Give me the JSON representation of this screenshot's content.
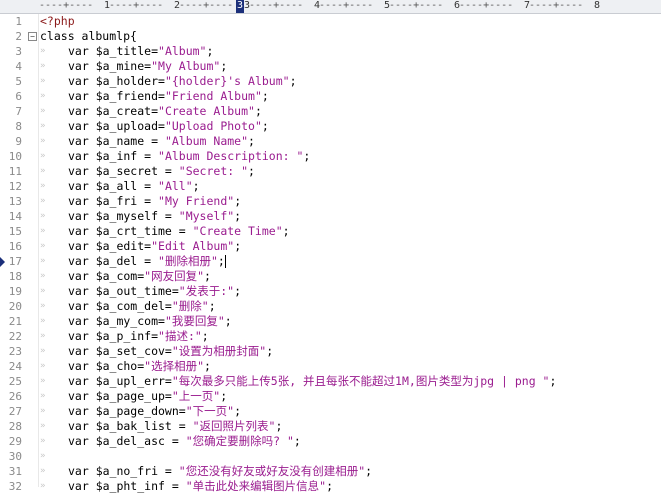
{
  "ruler": {
    "numbers": [
      "1",
      "2",
      "3",
      "4",
      "5",
      "6",
      "7",
      "8"
    ],
    "cursor_col": "3"
  },
  "code_lines": [
    {
      "n": "1",
      "text": "<?php",
      "kind": "php"
    },
    {
      "n": "2",
      "text": "class albumlp{",
      "kind": "class",
      "fold": "−"
    },
    {
      "n": "3",
      "pre": "var $a_title=",
      "str": "\"Album\"",
      "post": ";"
    },
    {
      "n": "4",
      "pre": "var $a_mine=",
      "str": "\"My Album\"",
      "post": ";"
    },
    {
      "n": "5",
      "pre": "var $a_holder=",
      "str": "\"{holder}'s Album\"",
      "post": ";"
    },
    {
      "n": "6",
      "pre": "var $a_friend=",
      "str": "\"Friend Album\"",
      "post": ";"
    },
    {
      "n": "7",
      "pre": "var $a_creat=",
      "str": "\"Create Album\"",
      "post": ";"
    },
    {
      "n": "8",
      "pre": "var $a_upload=",
      "str": "\"Upload Photo\"",
      "post": ";"
    },
    {
      "n": "9",
      "pre": "var $a_name = ",
      "str": "\"Album Name\"",
      "post": ";"
    },
    {
      "n": "10",
      "pre": "var $a_inf = ",
      "str": "\"Album Description: \"",
      "post": ";"
    },
    {
      "n": "11",
      "pre": "var $a_secret = ",
      "str": "\"Secret: \"",
      "post": ";"
    },
    {
      "n": "12",
      "pre": "var $a_all = ",
      "str": "\"All\"",
      "post": ";"
    },
    {
      "n": "13",
      "pre": "var $a_fri = ",
      "str": "\"My Friend\"",
      "post": ";"
    },
    {
      "n": "14",
      "pre": "var $a_myself = ",
      "str": "\"Myself\"",
      "post": ";"
    },
    {
      "n": "15",
      "pre": "var $a_crt_time = ",
      "str": "\"Create Time\"",
      "post": ";"
    },
    {
      "n": "16",
      "pre": "var $a_edit=",
      "str": "\"Edit Album\"",
      "post": ";"
    },
    {
      "n": "17",
      "pre": "var $a_del = ",
      "str": "\"删除相册\"",
      "post": ";",
      "current": true
    },
    {
      "n": "18",
      "pre": "var $a_com=",
      "str": "\"网友回复\"",
      "post": ";"
    },
    {
      "n": "19",
      "pre": "var $a_out_time=",
      "str": "\"发表于:\"",
      "post": ";"
    },
    {
      "n": "20",
      "pre": "var $a_com_del=",
      "str": "\"删除\"",
      "post": ";"
    },
    {
      "n": "21",
      "pre": "var $a_my_com=",
      "str": "\"我要回复\"",
      "post": ";"
    },
    {
      "n": "22",
      "pre": "var $a_p_inf=",
      "str": "\"描述:\"",
      "post": ";"
    },
    {
      "n": "23",
      "pre": "var $a_set_cov=",
      "str": "\"设置为相册封面\"",
      "post": ";"
    },
    {
      "n": "24",
      "pre": "var $a_cho=",
      "str": "\"选择相册\"",
      "post": ";"
    },
    {
      "n": "25",
      "pre": "var $a_upl_err=",
      "str": "\"每次最多只能上传5张, 并且每张不能超过1M,图片类型为jpg | png \"",
      "post": ";"
    },
    {
      "n": "26",
      "pre": "var $a_page_up=",
      "str": "\"上一页\"",
      "post": ";"
    },
    {
      "n": "27",
      "pre": "var $a_page_down=",
      "str": "\"下一页\"",
      "post": ";"
    },
    {
      "n": "28",
      "pre": "var $a_bak_list = ",
      "str": "\"返回照片列表\"",
      "post": ";"
    },
    {
      "n": "29",
      "pre": "var $a_del_asc = ",
      "str": "\"您确定要删除吗? \"",
      "post": ";"
    },
    {
      "n": "30",
      "pre": "",
      "str": "",
      "post": ""
    },
    {
      "n": "31",
      "pre": "var $a_no_fri = ",
      "str": "\"您还没有好友或好友没有创建相册\"",
      "post": ";"
    },
    {
      "n": "32",
      "pre": "var $a_pht_inf = ",
      "str": "\"单击此处来编辑图片信息\"",
      "post": ";"
    }
  ]
}
